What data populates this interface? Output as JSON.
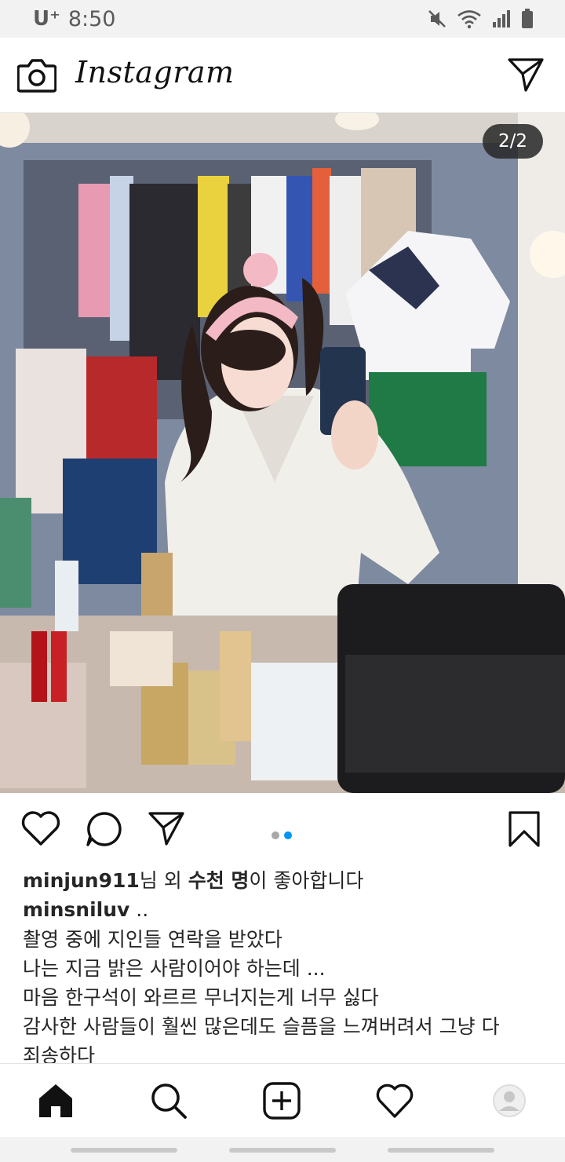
{
  "status_bar": {
    "carrier": "U⁺",
    "time": "8:50",
    "icons": [
      "mute-icon",
      "wifi-icon",
      "signal-icon",
      "battery-icon"
    ]
  },
  "header": {
    "logo": "Instagram",
    "icons": [
      "camera-icon",
      "direct-message-icon"
    ]
  },
  "post": {
    "image_counter": "2/2",
    "image_description_icons": [
      "carousel-dot",
      "carousel-dot-active"
    ],
    "carousel": {
      "total": 2,
      "current": 2
    },
    "likes": {
      "user": "minjun911",
      "text_mid": "님 외 ",
      "count": "수천 명",
      "text_end": "이 좋아합니다"
    },
    "caption": {
      "username": "minsniluv",
      "suffix": " ..",
      "lines": [
        "촬영 중에 지인들 연락을 받았다",
        "나는 지금 밝은 사람이어야 하는데 ...",
        "마음 한구석이 와르르 무너지는게 너무 싫다",
        "감사한 사람들이 훨씬 많은데도 슬픔을 느껴버려서 그냥 다",
        "죄송하다"
      ]
    }
  },
  "actions": [
    "heart-icon",
    "comment-icon",
    "share-icon",
    "bookmark-icon"
  ],
  "nav": [
    "home-icon",
    "search-icon",
    "add-post-icon",
    "activity-heart-icon",
    "profile-avatar"
  ],
  "colors": {
    "accent": "#0095f6",
    "text": "#262626",
    "status_bar_bg": "#f2f2f2"
  }
}
